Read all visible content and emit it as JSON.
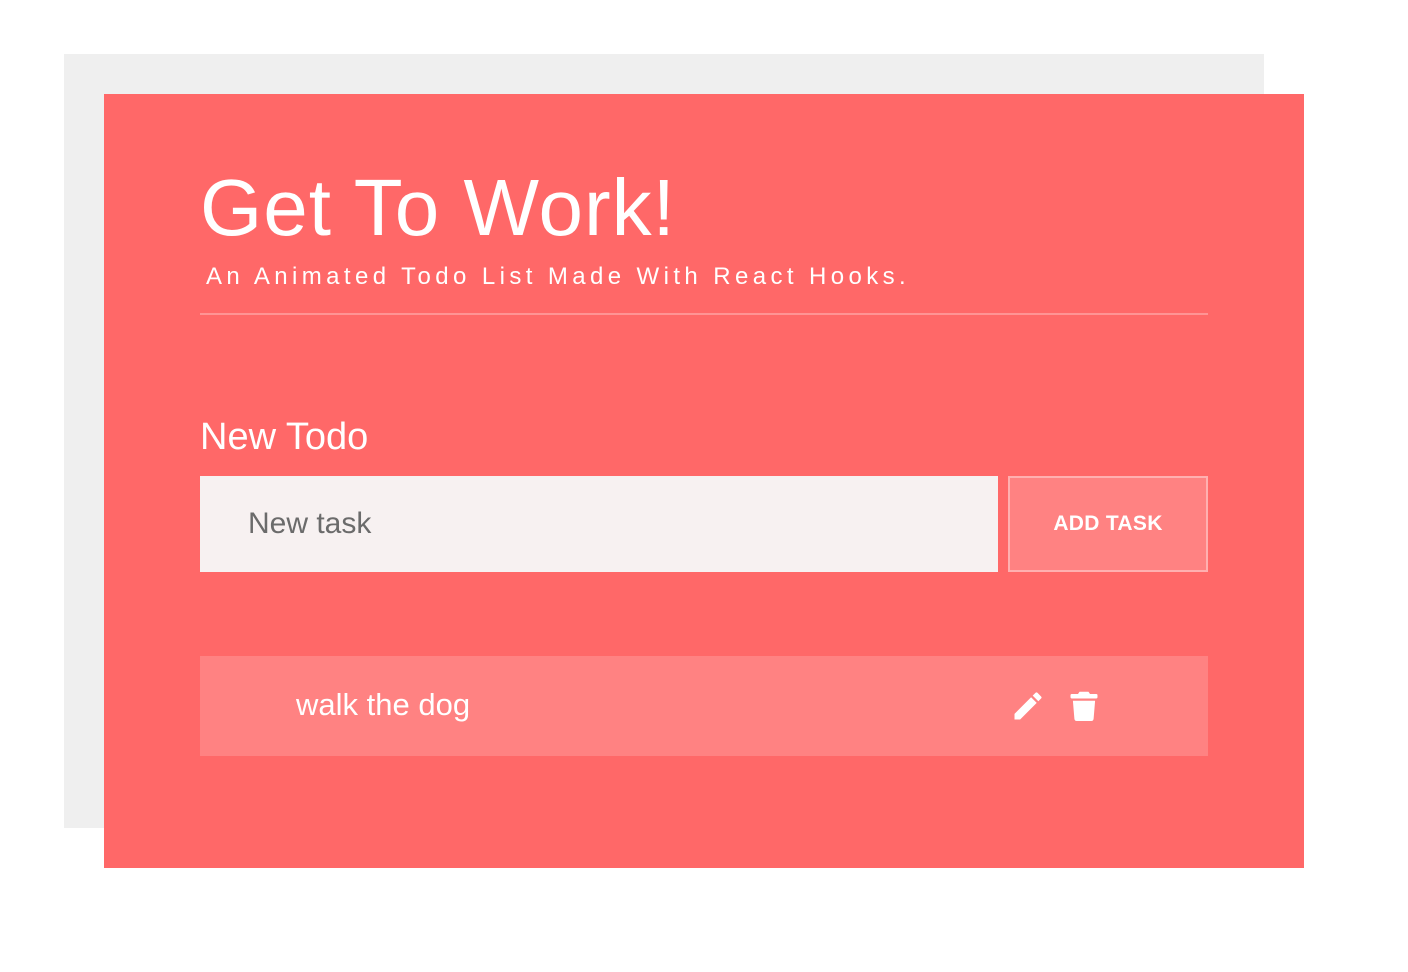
{
  "colors": {
    "background": "#ffffff",
    "shadow_card": "#efefef",
    "card": "#ff6868",
    "accent_light": "#ff8282",
    "divider": "#ff9494",
    "input_background": "#f7f1f1",
    "text": "#ffffff"
  },
  "header": {
    "title": "Get To Work!",
    "subtitle": "An Animated Todo List Made With React Hooks."
  },
  "form": {
    "label": "New Todo",
    "input_placeholder": "New task",
    "input_value": "",
    "button_label": "ADD TASK"
  },
  "todos": [
    {
      "text": "walk the dog",
      "actions": [
        "pencil-icon",
        "trash-icon"
      ]
    }
  ]
}
